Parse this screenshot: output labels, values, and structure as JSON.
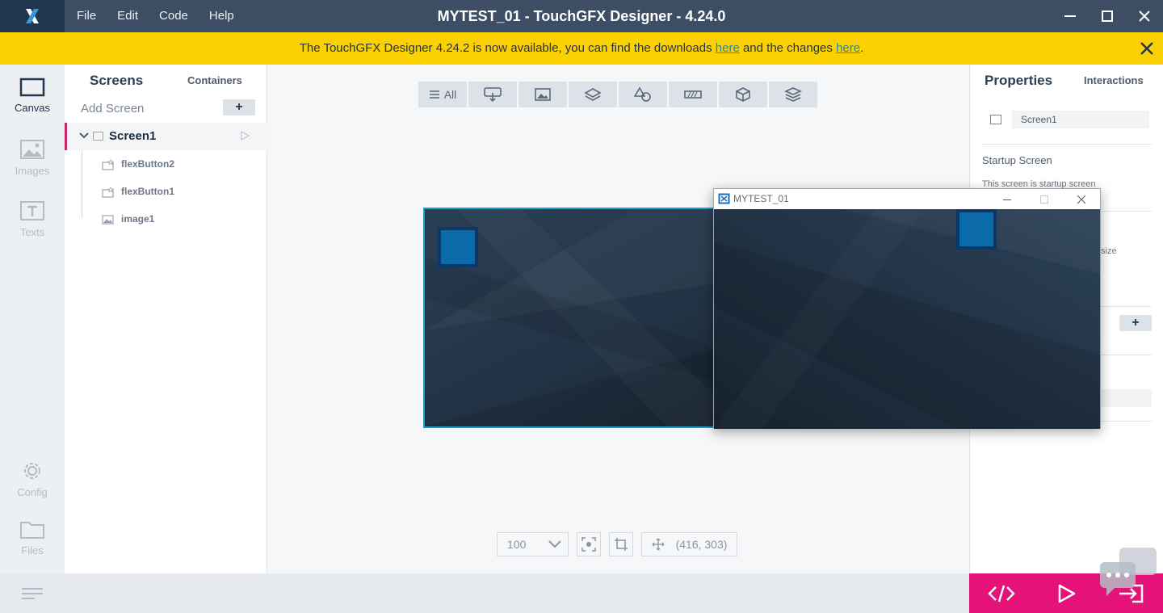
{
  "app": {
    "title": "MYTEST_01 - TouchGFX Designer - 4.24.0",
    "menu": [
      "File",
      "Edit",
      "Code",
      "Help"
    ]
  },
  "banner": {
    "text_before": "The TouchGFX Designer 4.24.2 is now available, you can find the downloads ",
    "link1": "here",
    "text_middle": " and the changes ",
    "link2": "here",
    "text_after": "."
  },
  "rail": {
    "canvas": "Canvas",
    "images": "Images",
    "texts": "Texts",
    "config": "Config",
    "files": "Files"
  },
  "screens_panel": {
    "tab_screens": "Screens",
    "tab_containers": "Containers",
    "add_screen": "Add Screen",
    "add_plus": "+",
    "screen_name": "Screen1",
    "widgets": [
      {
        "name": "flexButton2",
        "icon": "button-icon"
      },
      {
        "name": "flexButton1",
        "icon": "button-icon"
      },
      {
        "name": "image1",
        "icon": "image-icon"
      }
    ]
  },
  "canvas": {
    "filter_all": "All",
    "zoom": "100",
    "cursor_pos": "(416, 303)"
  },
  "properties": {
    "tab_properties": "Properties",
    "tab_interactions": "Interactions",
    "screen_name": "Screen1",
    "startup_label": "Startup Screen",
    "startup_desc": "This screen is startup screen",
    "size_fragment": "size",
    "plus": "+"
  },
  "simulator": {
    "title": "MYTEST_01"
  },
  "colors": {
    "titlebar": "#3d4d64",
    "banner": "#fcd101",
    "accent": "#e5127a",
    "selection": "#1b9ad6"
  }
}
